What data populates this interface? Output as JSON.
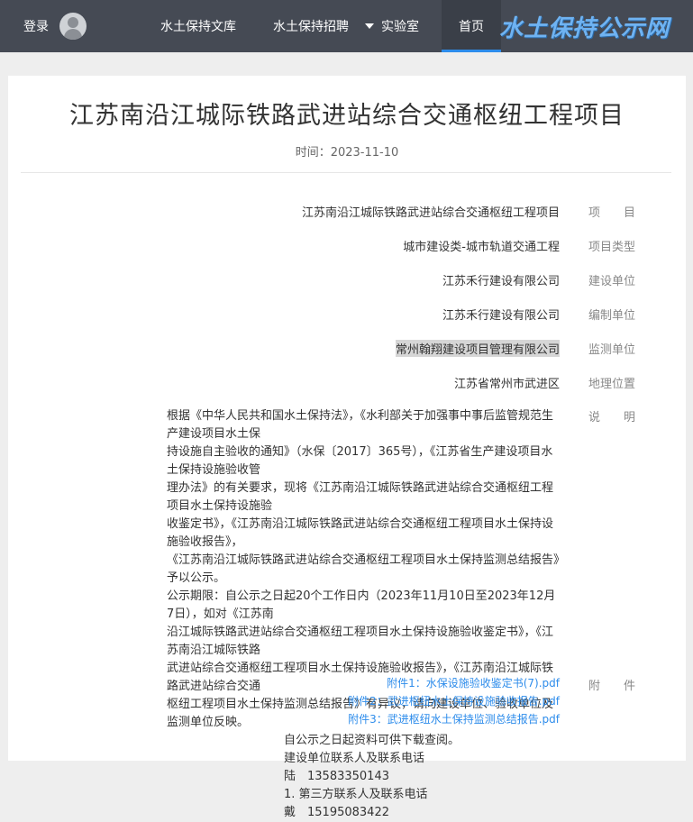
{
  "header": {
    "logo_text": "水土保持公示网",
    "nav_home": "首页",
    "nav_lab": "实验室",
    "nav_recruit": "水土保持招聘",
    "nav_library": "水土保持文库",
    "login": "登录",
    "accent_color": "#2d8ceb"
  },
  "article": {
    "title": "江苏南沿江城际铁路武进站综合交通枢纽工程项目",
    "time_label": "时间：",
    "time_value": "2023-11-10",
    "fields": [
      {
        "label": "项　　目",
        "value": "江苏南沿江城际铁路武进站综合交通枢纽工程项目"
      },
      {
        "label": "项目类型",
        "value": "城市建设类-城市轨道交通工程"
      },
      {
        "label": "建设单位",
        "value": "江苏禾行建设有限公司"
      },
      {
        "label": "编制单位",
        "value": "江苏禾行建设有限公司"
      },
      {
        "label": "监测单位",
        "value": "常州翰翔建设项目管理有限公司"
      },
      {
        "label": "地理位置",
        "value": "江苏省常州市武进区"
      }
    ],
    "desc_label": "说　　明",
    "desc_lines": [
      "根据《中华人民共和国水土保持法》，《水利部关于加强事中事后监管规范生产建设项目水土保",
      "持设施自主验收的通知》（水保〔2017〕365号），《江苏省生产建设项目水土保持设施验收管",
      "理办法》的有关要求，现将《江苏南沿江城际铁路武进站综合交通枢纽工程项目水土保持设施验",
      "收鉴定书》，《江苏南沿江城际铁路武进站综合交通枢纽工程项目水土保持设施验收报告》，",
      "《江苏南沿江城际铁路武进站综合交通枢纽工程项目水土保持监测总结报告》予以公示。",
      "公示期限：自公示之日起20个工作日内（2023年11月10日至2023年12月7日），如对《江苏南",
      "沿江城际铁路武进站综合交通枢纽工程项目水土保持设施验收鉴定书》，《江苏南沿江城际铁路",
      "武进站综合交通枢纽工程项目水土保持设施验收报告》，《江苏南沿江城际铁路武进站综合交通",
      "枢纽工程项目水土保持监测总结报告》有异议，请向建设单位、验收单位及监测单位反映。"
    ],
    "desc_indent_lines": [
      "自公示之日起资料可供下载查阅。",
      "建设单位联系人及联系电话",
      "陆　13583350143",
      "1. 第三方联系人及联系电话",
      "戴　15195083422"
    ],
    "attach_label": "附　　件",
    "attachments": [
      "附件1：水保设施验收鉴定书(7).pdf",
      "附件2：武进枢纽水土保持设施验收报告.pdf",
      "附件3：武进枢纽水土保持监测总结报告.pdf"
    ]
  }
}
